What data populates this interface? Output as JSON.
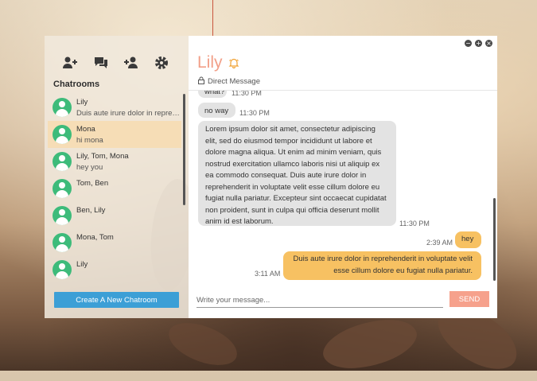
{
  "toolbar": {
    "icons": [
      "add-contact-icon",
      "chats-icon",
      "add-user-icon",
      "settings-icon"
    ]
  },
  "sidebar": {
    "title": "Chatrooms",
    "rooms": [
      {
        "name": "Lily",
        "preview": "Duis aute irure dolor in reprehenderit in voluptate",
        "active": false
      },
      {
        "name": "Mona",
        "preview": "hi mona",
        "active": true
      },
      {
        "name": "Lily, Tom, Mona",
        "preview": "hey you",
        "active": false
      },
      {
        "name": "Tom, Ben",
        "preview": "",
        "active": false
      },
      {
        "name": "Ben, Lily",
        "preview": "",
        "active": false
      },
      {
        "name": "Mona, Tom",
        "preview": "",
        "active": false
      },
      {
        "name": "Lily",
        "preview": "",
        "active": false
      }
    ],
    "create_label": "Create A New Chatroom"
  },
  "window_controls": {
    "minimize": "−",
    "maximize": "+",
    "close": "×"
  },
  "chat": {
    "contact_name": "Lily",
    "subtitle": "Direct Message",
    "messages": [
      {
        "direction": "in",
        "text": "what?",
        "time": "11:30 PM"
      },
      {
        "direction": "in",
        "text": "no way",
        "time": "11:30 PM"
      },
      {
        "direction": "in",
        "text": "Lorem ipsum dolor sit amet, consectetur adipiscing elit, sed do eiusmod tempor incididunt ut labore et dolore magna aliqua. Ut enim ad minim veniam, quis nostrud exercitation ullamco laboris nisi ut aliquip ex ea commodo consequat. Duis aute irure dolor in reprehenderit in voluptate velit esse cillum dolore eu fugiat nulla pariatur. Excepteur sint occaecat cupidatat non proident, sunt in culpa qui officia deserunt mollit anim id est laborum.",
        "time": "11:30 PM"
      },
      {
        "direction": "out",
        "text": "hey",
        "time": "2:39 AM"
      },
      {
        "direction": "out",
        "text": "Duis aute irure dolor in reprehenderit in voluptate velit esse cillum dolore eu fugiat nulla pariatur.",
        "time": "3:11 AM"
      }
    ],
    "input_placeholder": "Write your message...",
    "send_label": "SEND"
  },
  "colors": {
    "accent_contact": "#f29f88",
    "avatar": "#3dbb7a",
    "create_button": "#3c9fd6",
    "outgoing_bubble": "#f7c162",
    "incoming_bubble": "#e3e3e3",
    "send_button": "#f6a18c",
    "active_room": "#f6ddb6"
  }
}
